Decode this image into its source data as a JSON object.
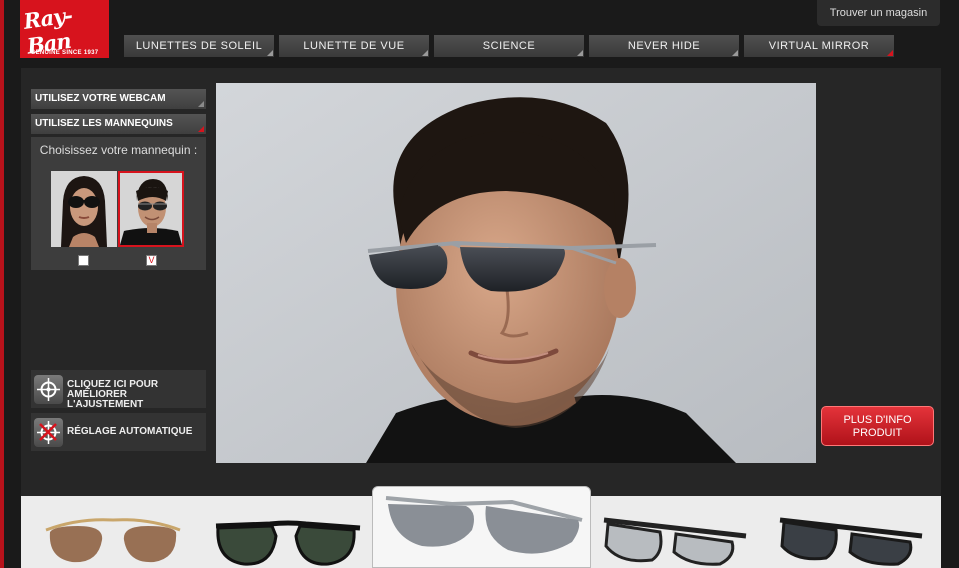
{
  "brand": {
    "logo_script": "Ray-Ban",
    "tagline": "GENUINE SINCE 1937"
  },
  "header": {
    "store_locator_label": "Trouver un magasin"
  },
  "nav": [
    {
      "label": "LUNETTES DE SOLEIL"
    },
    {
      "label": "LUNETTE DE VUE"
    },
    {
      "label": "SCIENCE"
    },
    {
      "label": "NEVER HIDE"
    },
    {
      "label": "VIRTUAL MIRROR"
    }
  ],
  "sidebar": {
    "webcam_label": "UTILISEZ VOTRE WEBCAM",
    "mannequins_label": "UTILISEZ LES MANNEQUINS",
    "choose_label": "Choisissez votre mannequin :",
    "mannequins": [
      {
        "name": "female",
        "selected": false
      },
      {
        "name": "male",
        "selected": true
      }
    ],
    "checkbox_mark": "V",
    "adjust_label_line1": "CLIQUEZ ICI POUR",
    "adjust_label_line2": "AMÉLIORER L'AJUSTEMENT",
    "auto_label": "RÉGLAGE AUTOMATIQUE"
  },
  "info_button": {
    "line1": "PLUS D'INFO",
    "line2": "PRODUIT"
  },
  "products": [
    {
      "style": "aviator",
      "lens_color": "#8a5a3a",
      "frame_color": "#c9a66b",
      "selected": false
    },
    {
      "style": "aviator-black",
      "lens_color": "#3a4a3a",
      "frame_color": "#111111",
      "selected": false
    },
    {
      "style": "rimless-sport",
      "lens_color": "#8a8f96",
      "frame_color": "#9ea3a8",
      "selected": true
    },
    {
      "style": "wayfarer-clear",
      "lens_color": "#b8bcc0",
      "frame_color": "#222222",
      "selected": false
    },
    {
      "style": "wrap",
      "lens_color": "#3a3f45",
      "frame_color": "#1a1a1a",
      "selected": false
    }
  ],
  "colors": {
    "brand_red": "#d7131d",
    "background": "#1a1a1a"
  }
}
